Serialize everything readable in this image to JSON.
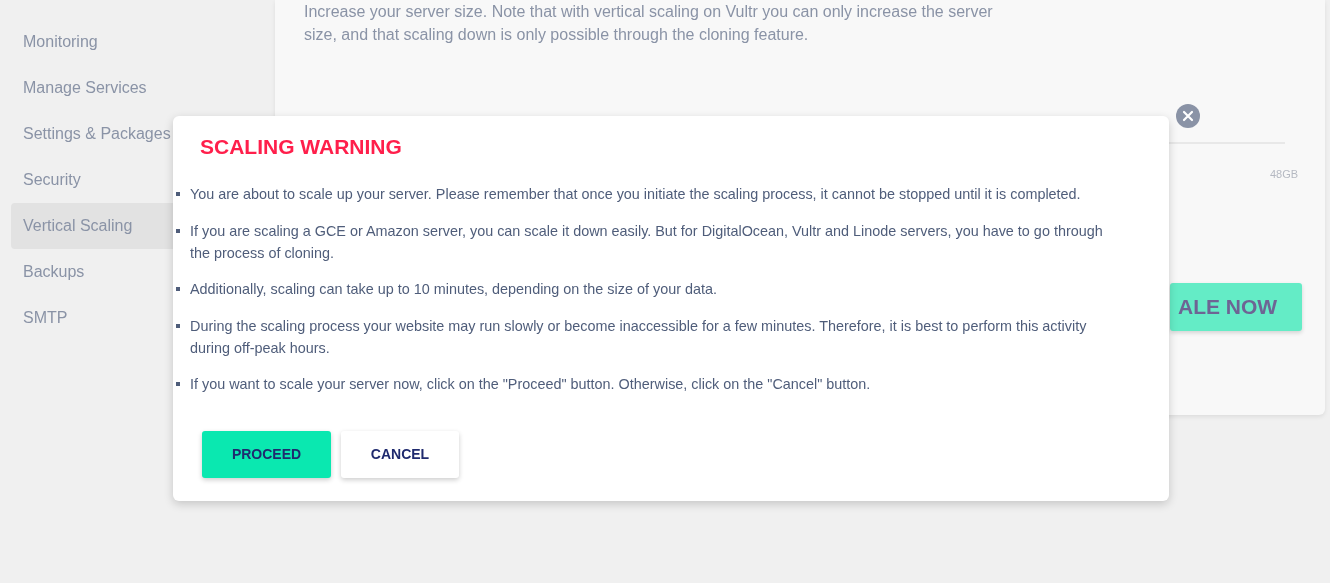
{
  "sidebar": {
    "items": [
      {
        "label": "Monitoring",
        "selected": false
      },
      {
        "label": "Manage Services",
        "selected": false
      },
      {
        "label": "Settings & Packages",
        "selected": false
      },
      {
        "label": "Security",
        "selected": false
      },
      {
        "label": "Vertical Scaling",
        "selected": true
      },
      {
        "label": "Backups",
        "selected": false
      },
      {
        "label": "SMTP",
        "selected": false
      }
    ]
  },
  "page": {
    "description": "Increase your server size. Note that with vertical scaling on Vultr you can only increase the server size, and that scaling down is only possible through the cloning feature.",
    "size_label": "48GB",
    "scale_button": "ALE NOW"
  },
  "dialog": {
    "title": "SCALING WARNING",
    "bullets": [
      "You are about to scale up your server. Please remember that once you initiate the scaling process, it cannot be stopped until it is completed.",
      "If you are scaling a GCE or Amazon server, you can scale it down easily. But for DigitalOcean, Vultr and Linode servers, you have to go through the process of cloning.",
      "Additionally, scaling can take up to 10 minutes, depending on the size of your data.",
      "During the scaling process your website may run slowly or become inaccessible for a few minutes. Therefore, it is best to perform this activity during off-peak hours.",
      "If you want to scale your server now, click on the \"Proceed\" button. Otherwise, click on the \"Cancel\" button."
    ],
    "buttons": [
      {
        "label": "PROCEED",
        "kind": "primary"
      },
      {
        "label": "CANCEL",
        "kind": "secondary"
      }
    ]
  }
}
